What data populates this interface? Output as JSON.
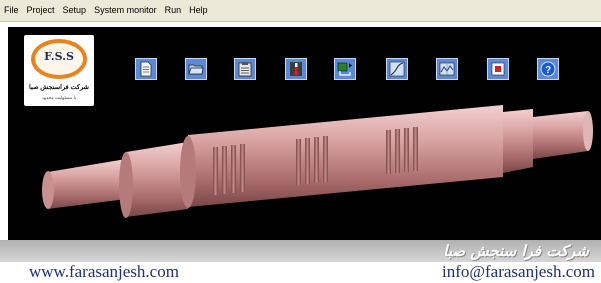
{
  "menu": [
    "File",
    "Project",
    "Setup",
    "System monitor",
    "Run",
    "Help"
  ],
  "logo": {
    "initials": "F.S.S",
    "name_fa": "شرکت فراسنجش صبا",
    "tagline_fa": "با مسئولیت محدود"
  },
  "toolbar": [
    {
      "icon": "new-document-icon"
    },
    {
      "icon": "open-folder-icon"
    },
    {
      "icon": "clipboard-icon"
    },
    {
      "icon": "thermometer-icon"
    },
    {
      "icon": "hardware-connect-icon"
    },
    {
      "icon": "curve-graph-icon"
    },
    {
      "icon": "signal-monitor-icon"
    },
    {
      "icon": "stop-icon"
    },
    {
      "icon": "help-icon"
    }
  ],
  "footer": {
    "company_fa": "شرکت فرا سنجش صبا",
    "website": "www.farasanjesh.com",
    "email": "info@farasanjesh.com"
  },
  "colors": {
    "menubar": "#ece9d8",
    "canvas": "#000000",
    "toolbar_button": "#5a8ad6",
    "shaft": "#d7a0a0",
    "link_text": "#1f3170"
  }
}
